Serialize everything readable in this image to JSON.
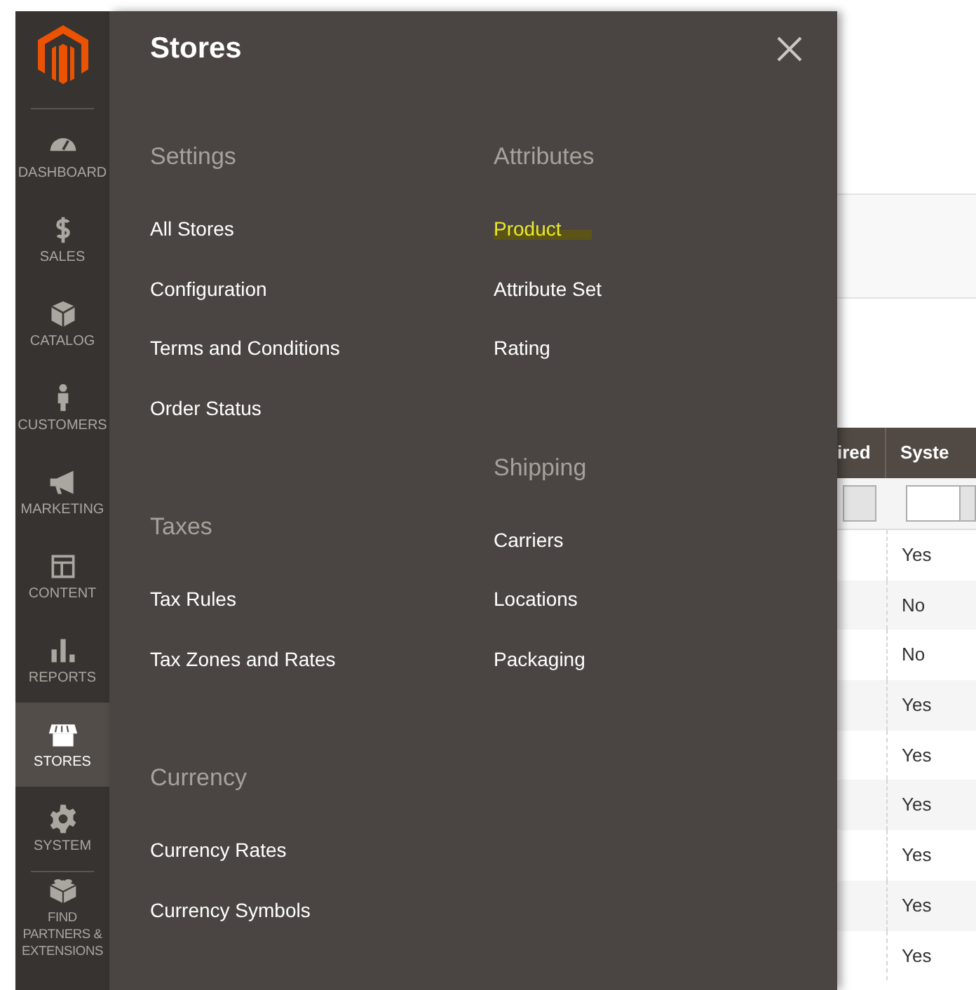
{
  "sidebar": {
    "items": [
      {
        "label": "DASHBOARD",
        "selected": false
      },
      {
        "label": "SALES",
        "selected": false
      },
      {
        "label": "CATALOG",
        "selected": false
      },
      {
        "label": "CUSTOMERS",
        "selected": false
      },
      {
        "label": "MARKETING",
        "selected": false
      },
      {
        "label": "CONTENT",
        "selected": false
      },
      {
        "label": "REPORTS",
        "selected": false
      },
      {
        "label": "STORES",
        "selected": true
      },
      {
        "label": "SYSTEM",
        "selected": false
      },
      {
        "label": "FIND PARTNERS & EXTENSIONS",
        "selected": false
      }
    ]
  },
  "flyout": {
    "title": "Stores",
    "columns": [
      {
        "sections": [
          {
            "heading": "Settings",
            "items": [
              {
                "label": "All Stores",
                "highlighted": false
              },
              {
                "label": "Configuration",
                "highlighted": false
              },
              {
                "label": "Terms and Conditions",
                "highlighted": false
              },
              {
                "label": "Order Status",
                "highlighted": false
              }
            ]
          },
          {
            "heading": "Taxes",
            "items": [
              {
                "label": "Tax Rules",
                "highlighted": false
              },
              {
                "label": "Tax Zones and Rates",
                "highlighted": false
              }
            ]
          },
          {
            "heading": "Currency",
            "items": [
              {
                "label": "Currency Rates",
                "highlighted": false
              },
              {
                "label": "Currency Symbols",
                "highlighted": false
              }
            ]
          }
        ]
      },
      {
        "sections": [
          {
            "heading": "Attributes",
            "items": [
              {
                "label": "Product",
                "highlighted": true
              },
              {
                "label": "Attribute Set",
                "highlighted": false
              },
              {
                "label": "Rating",
                "highlighted": false
              }
            ]
          },
          {
            "heading": "Shipping",
            "items": [
              {
                "label": "Carriers",
                "highlighted": false
              },
              {
                "label": "Locations",
                "highlighted": false
              },
              {
                "label": "Packaging",
                "highlighted": false
              }
            ]
          }
        ]
      }
    ]
  },
  "table": {
    "columns": [
      "ired",
      "Syste"
    ],
    "rows": [
      "Yes",
      "No",
      "No",
      "Yes",
      "Yes",
      "Yes",
      "Yes",
      "Yes",
      "Yes"
    ]
  }
}
